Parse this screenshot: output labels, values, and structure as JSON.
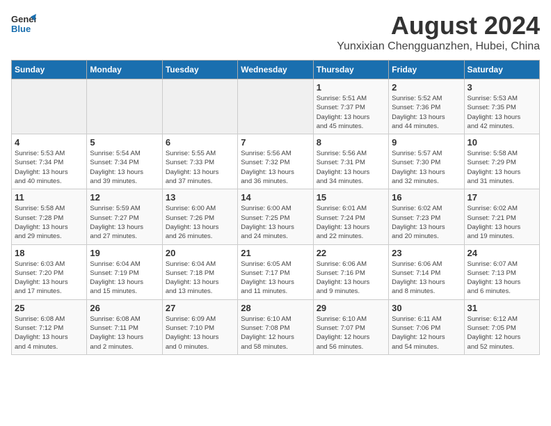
{
  "logo": {
    "general": "General",
    "blue": "Blue"
  },
  "title": "August 2024",
  "subtitle": "Yunxixian Chengguanzhen, Hubei, China",
  "days_of_week": [
    "Sunday",
    "Monday",
    "Tuesday",
    "Wednesday",
    "Thursday",
    "Friday",
    "Saturday"
  ],
  "weeks": [
    [
      {
        "day": "",
        "info": ""
      },
      {
        "day": "",
        "info": ""
      },
      {
        "day": "",
        "info": ""
      },
      {
        "day": "",
        "info": ""
      },
      {
        "day": "1",
        "info": "Sunrise: 5:51 AM\nSunset: 7:37 PM\nDaylight: 13 hours\nand 45 minutes."
      },
      {
        "day": "2",
        "info": "Sunrise: 5:52 AM\nSunset: 7:36 PM\nDaylight: 13 hours\nand 44 minutes."
      },
      {
        "day": "3",
        "info": "Sunrise: 5:53 AM\nSunset: 7:35 PM\nDaylight: 13 hours\nand 42 minutes."
      }
    ],
    [
      {
        "day": "4",
        "info": "Sunrise: 5:53 AM\nSunset: 7:34 PM\nDaylight: 13 hours\nand 40 minutes."
      },
      {
        "day": "5",
        "info": "Sunrise: 5:54 AM\nSunset: 7:34 PM\nDaylight: 13 hours\nand 39 minutes."
      },
      {
        "day": "6",
        "info": "Sunrise: 5:55 AM\nSunset: 7:33 PM\nDaylight: 13 hours\nand 37 minutes."
      },
      {
        "day": "7",
        "info": "Sunrise: 5:56 AM\nSunset: 7:32 PM\nDaylight: 13 hours\nand 36 minutes."
      },
      {
        "day": "8",
        "info": "Sunrise: 5:56 AM\nSunset: 7:31 PM\nDaylight: 13 hours\nand 34 minutes."
      },
      {
        "day": "9",
        "info": "Sunrise: 5:57 AM\nSunset: 7:30 PM\nDaylight: 13 hours\nand 32 minutes."
      },
      {
        "day": "10",
        "info": "Sunrise: 5:58 AM\nSunset: 7:29 PM\nDaylight: 13 hours\nand 31 minutes."
      }
    ],
    [
      {
        "day": "11",
        "info": "Sunrise: 5:58 AM\nSunset: 7:28 PM\nDaylight: 13 hours\nand 29 minutes."
      },
      {
        "day": "12",
        "info": "Sunrise: 5:59 AM\nSunset: 7:27 PM\nDaylight: 13 hours\nand 27 minutes."
      },
      {
        "day": "13",
        "info": "Sunrise: 6:00 AM\nSunset: 7:26 PM\nDaylight: 13 hours\nand 26 minutes."
      },
      {
        "day": "14",
        "info": "Sunrise: 6:00 AM\nSunset: 7:25 PM\nDaylight: 13 hours\nand 24 minutes."
      },
      {
        "day": "15",
        "info": "Sunrise: 6:01 AM\nSunset: 7:24 PM\nDaylight: 13 hours\nand 22 minutes."
      },
      {
        "day": "16",
        "info": "Sunrise: 6:02 AM\nSunset: 7:23 PM\nDaylight: 13 hours\nand 20 minutes."
      },
      {
        "day": "17",
        "info": "Sunrise: 6:02 AM\nSunset: 7:21 PM\nDaylight: 13 hours\nand 19 minutes."
      }
    ],
    [
      {
        "day": "18",
        "info": "Sunrise: 6:03 AM\nSunset: 7:20 PM\nDaylight: 13 hours\nand 17 minutes."
      },
      {
        "day": "19",
        "info": "Sunrise: 6:04 AM\nSunset: 7:19 PM\nDaylight: 13 hours\nand 15 minutes."
      },
      {
        "day": "20",
        "info": "Sunrise: 6:04 AM\nSunset: 7:18 PM\nDaylight: 13 hours\nand 13 minutes."
      },
      {
        "day": "21",
        "info": "Sunrise: 6:05 AM\nSunset: 7:17 PM\nDaylight: 13 hours\nand 11 minutes."
      },
      {
        "day": "22",
        "info": "Sunrise: 6:06 AM\nSunset: 7:16 PM\nDaylight: 13 hours\nand 9 minutes."
      },
      {
        "day": "23",
        "info": "Sunrise: 6:06 AM\nSunset: 7:14 PM\nDaylight: 13 hours\nand 8 minutes."
      },
      {
        "day": "24",
        "info": "Sunrise: 6:07 AM\nSunset: 7:13 PM\nDaylight: 13 hours\nand 6 minutes."
      }
    ],
    [
      {
        "day": "25",
        "info": "Sunrise: 6:08 AM\nSunset: 7:12 PM\nDaylight: 13 hours\nand 4 minutes."
      },
      {
        "day": "26",
        "info": "Sunrise: 6:08 AM\nSunset: 7:11 PM\nDaylight: 13 hours\nand 2 minutes."
      },
      {
        "day": "27",
        "info": "Sunrise: 6:09 AM\nSunset: 7:10 PM\nDaylight: 13 hours\nand 0 minutes."
      },
      {
        "day": "28",
        "info": "Sunrise: 6:10 AM\nSunset: 7:08 PM\nDaylight: 12 hours\nand 58 minutes."
      },
      {
        "day": "29",
        "info": "Sunrise: 6:10 AM\nSunset: 7:07 PM\nDaylight: 12 hours\nand 56 minutes."
      },
      {
        "day": "30",
        "info": "Sunrise: 6:11 AM\nSunset: 7:06 PM\nDaylight: 12 hours\nand 54 minutes."
      },
      {
        "day": "31",
        "info": "Sunrise: 6:12 AM\nSunset: 7:05 PM\nDaylight: 12 hours\nand 52 minutes."
      }
    ]
  ]
}
